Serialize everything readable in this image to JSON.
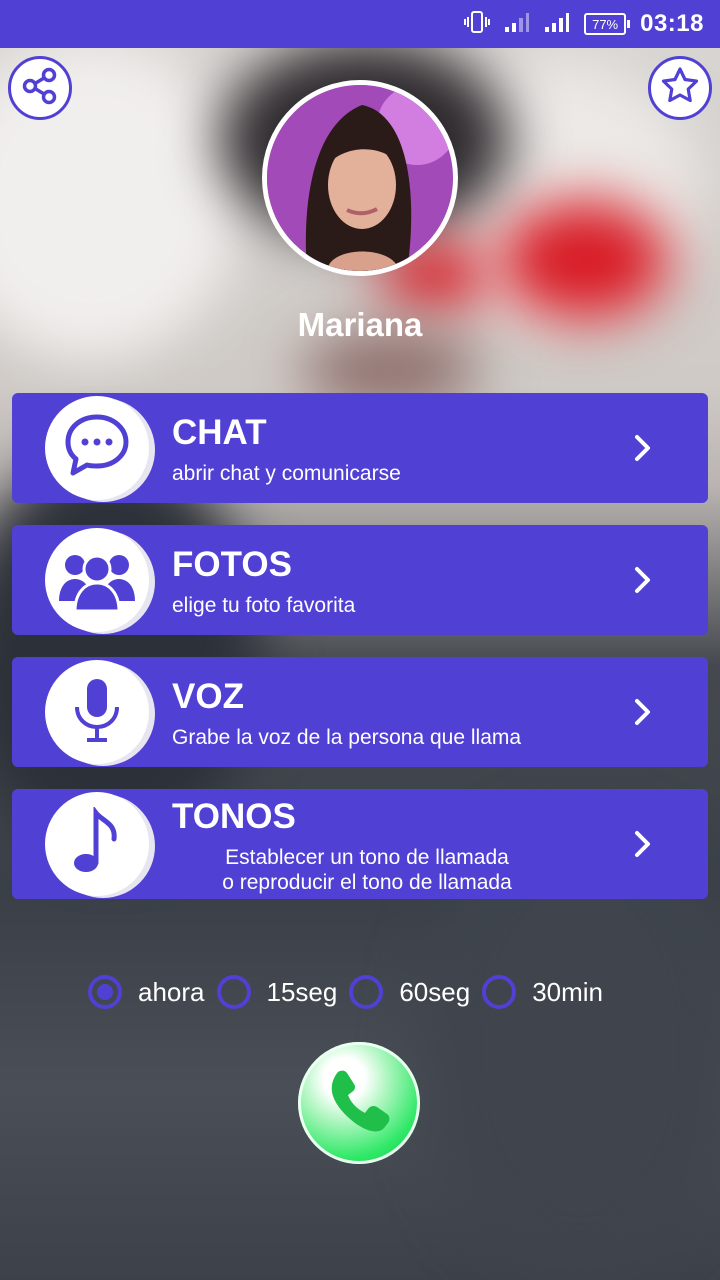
{
  "status_bar": {
    "time": "03:18",
    "battery": "77%"
  },
  "profile": {
    "name": "Mariana"
  },
  "menu": [
    {
      "title": "CHAT",
      "subtitle": "abrir chat y comunicarse",
      "icon": "chat-bubble-icon"
    },
    {
      "title": "FOTOS",
      "subtitle": "elige tu foto favorita",
      "icon": "group-icon"
    },
    {
      "title": "VOZ",
      "subtitle": "Grabe la voz de la persona que llama",
      "icon": "microphone-icon"
    },
    {
      "title": "TONOS",
      "subtitle_lines": [
        "Establecer un tono de llamada",
        "o reproducir el tono de llamada"
      ],
      "icon": "music-note-icon"
    }
  ],
  "timer_options": [
    {
      "label": "ahora",
      "selected": true
    },
    {
      "label": "15seg",
      "selected": false
    },
    {
      "label": "60seg",
      "selected": false
    },
    {
      "label": "30min",
      "selected": false
    }
  ],
  "colors": {
    "primary": "#5140d4",
    "call_green": "#2ee866"
  }
}
